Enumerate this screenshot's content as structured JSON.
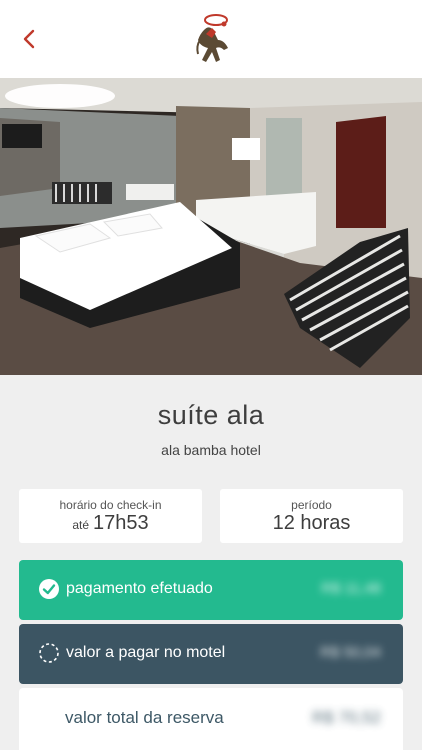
{
  "header": {
    "back_icon": "chevron-left-icon",
    "logo_icon": "horseman-logo-icon",
    "accent": "#c0392b"
  },
  "suite": {
    "name": "suíte ala",
    "hotel": "ala bamba hotel"
  },
  "checkin": {
    "label": "horário do check-in",
    "prefix": "até",
    "time": "17h53"
  },
  "period": {
    "label": "período",
    "value": "12 horas"
  },
  "payment": {
    "paid_label": "pagamento efetuado",
    "paid_amount": "R$ 11,48",
    "paid_color": "#23ba8f",
    "due_label": "valor a pagar no motel",
    "due_amount": "R$ 50,04",
    "due_color": "#3c5563",
    "total_label": "valor total da reserva",
    "total_amount": "R$ 70,52"
  }
}
